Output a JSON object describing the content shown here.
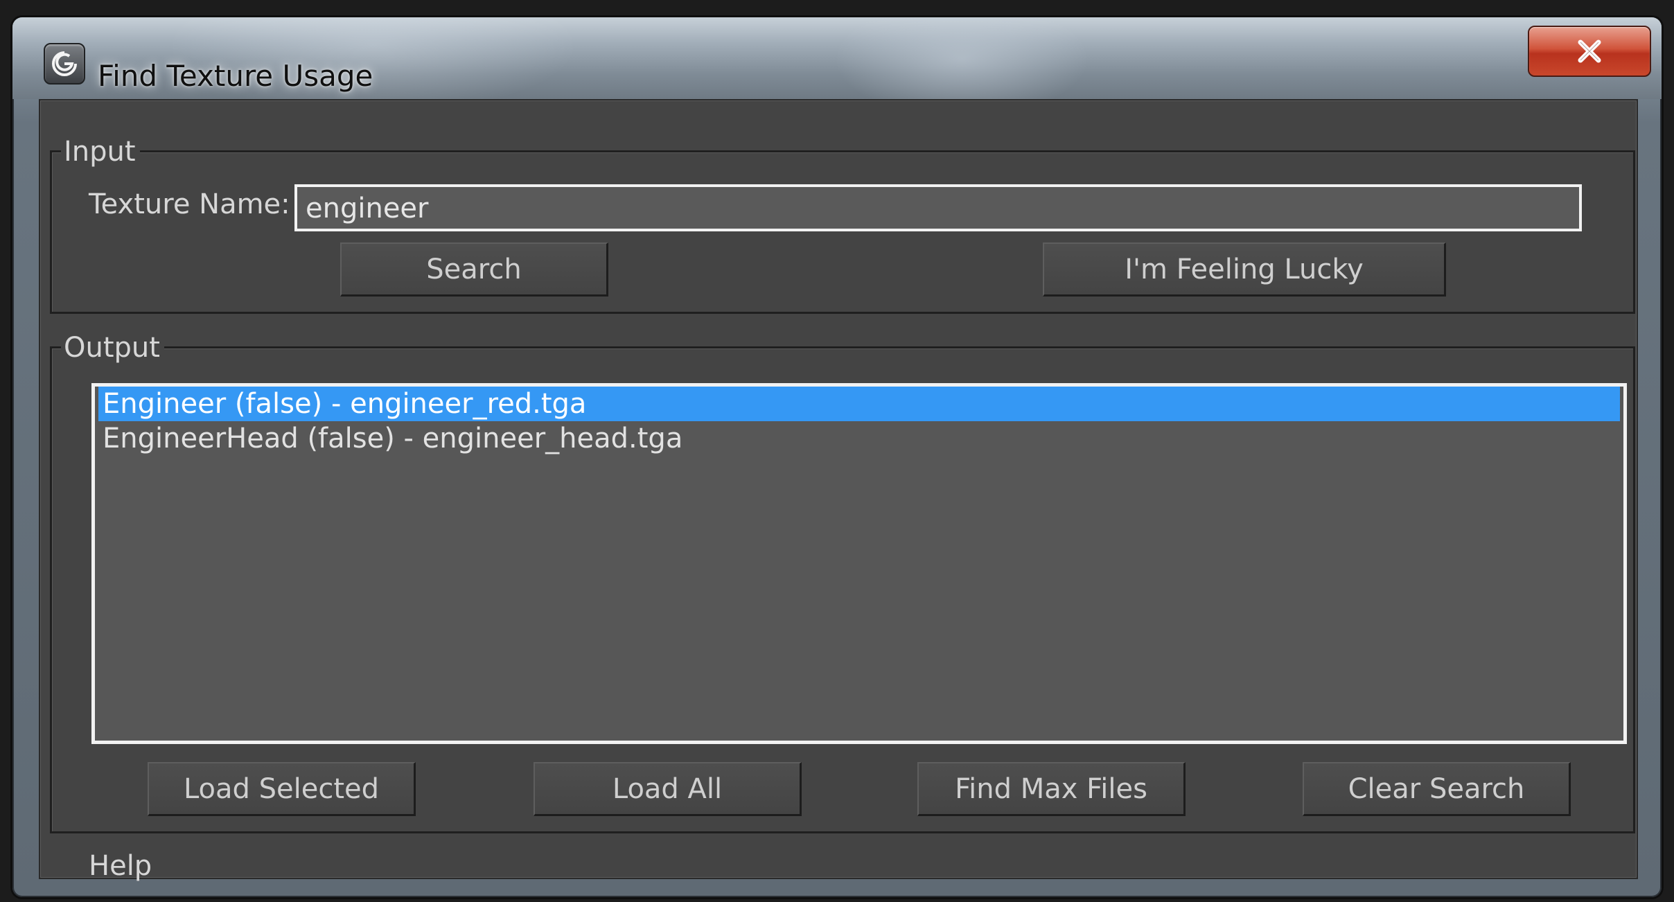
{
  "window": {
    "title": "Find Texture Usage",
    "close_label": "X",
    "icon": "3ds-max-icon"
  },
  "input_group": {
    "label": "Input",
    "texture_name_label": "Texture Name:",
    "texture_name_value": "engineer",
    "search_label": "Search",
    "lucky_label": "I'm Feeling Lucky"
  },
  "output_group": {
    "label": "Output",
    "items": [
      {
        "text": "Engineer (false) - engineer_red.tga",
        "selected": true
      },
      {
        "text": "EngineerHead (false) - engineer_head.tga",
        "selected": false
      }
    ],
    "load_selected_label": "Load Selected",
    "load_all_label": "Load All",
    "find_max_files_label": "Find Max Files",
    "clear_search_label": "Clear Search"
  },
  "footer": {
    "help_label": "Help"
  },
  "colors": {
    "panel_bg": "#444444",
    "list_bg": "#575757",
    "selection": "#3598f4",
    "text": "#d7d7d7"
  }
}
